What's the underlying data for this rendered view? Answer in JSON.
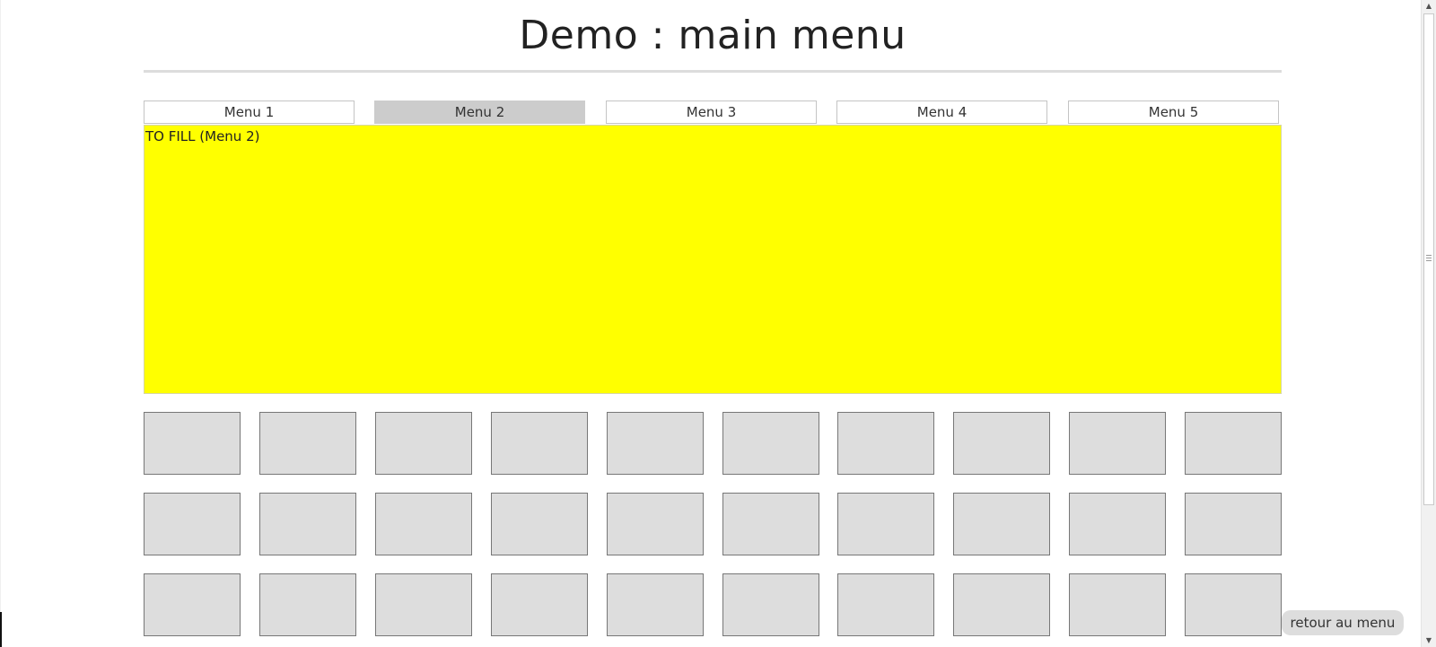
{
  "header": {
    "title": "Demo : main menu"
  },
  "menu": {
    "tabs": [
      {
        "label": "Menu 1",
        "active": false
      },
      {
        "label": "Menu 2",
        "active": true
      },
      {
        "label": "Menu 3",
        "active": false
      },
      {
        "label": "Menu 4",
        "active": false
      },
      {
        "label": "Menu 5",
        "active": false
      }
    ]
  },
  "content": {
    "text": "TO FILL (Menu 2)",
    "background_color": "#ffff00"
  },
  "grid": {
    "rows": 3,
    "columns": 10,
    "tile_color": "#dddddd"
  },
  "footer": {
    "back_button_label": "retour au menu"
  },
  "colors": {
    "active_tab": "#cccccc",
    "title_rule": "#dcdcdc"
  }
}
